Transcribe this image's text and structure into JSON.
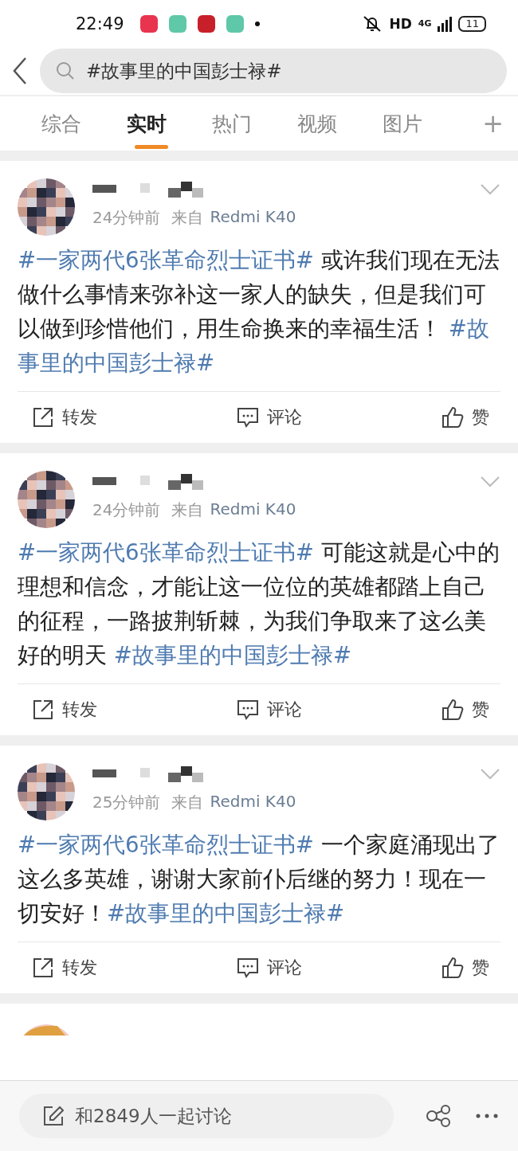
{
  "status_bar": {
    "time": "22:49",
    "network": "HD",
    "cellular": "4G",
    "battery": "11",
    "app_icons": [
      {
        "color": "#e8344e"
      },
      {
        "color": "#5fc8a8"
      },
      {
        "color": "#c8202a"
      },
      {
        "color": "#5fc8a8"
      }
    ]
  },
  "search": {
    "value": "#故事里的中国彭士禄#"
  },
  "tabs": [
    {
      "label": "综合",
      "selected": false
    },
    {
      "label": "实时",
      "selected": true
    },
    {
      "label": "热门",
      "selected": false
    },
    {
      "label": "视频",
      "selected": false
    },
    {
      "label": "图片",
      "selected": false
    }
  ],
  "add_tab": "+",
  "posts": [
    {
      "time": "24分钟前",
      "source_prefix": "来自",
      "source": "Redmi K40",
      "body": [
        {
          "kind": "tag",
          "text": "#一家两代6张革命烈士证书#"
        },
        {
          "kind": "plain",
          "text": " 或许我们现在无法做什么事情来弥补这一家人的缺失，但是我们可以做到珍惜他们，用生命换来的幸福生活！ "
        },
        {
          "kind": "tag",
          "text": "#故事里的中国彭士禄#"
        }
      ],
      "actions": [
        "转发",
        "评论",
        "赞"
      ]
    },
    {
      "time": "24分钟前",
      "source_prefix": "来自",
      "source": "Redmi K40",
      "body": [
        {
          "kind": "tag",
          "text": "#一家两代6张革命烈士证书#"
        },
        {
          "kind": "plain",
          "text": " 可能这就是心中的理想和信念，才能让这一位位的英雄都踏上自己的征程，一路披荆斩棘，为我们争取来了这么美好的明天 "
        },
        {
          "kind": "tag",
          "text": "#故事里的中国彭士禄#"
        }
      ],
      "actions": [
        "转发",
        "评论",
        "赞"
      ]
    },
    {
      "time": "25分钟前",
      "source_prefix": "来自",
      "source": "Redmi K40",
      "body": [
        {
          "kind": "tag",
          "text": "#一家两代6张革命烈士证书#"
        },
        {
          "kind": "plain",
          "text": " 一个家庭涌现出了这么多英雄，谢谢大家前仆后继的努力！现在一切安好！"
        },
        {
          "kind": "tag",
          "text": "#故事里的中国彭士禄#"
        }
      ],
      "actions": [
        "转发",
        "评论",
        "赞"
      ]
    }
  ],
  "bottom_bar": {
    "placeholder": "和2849人一起讨论"
  }
}
